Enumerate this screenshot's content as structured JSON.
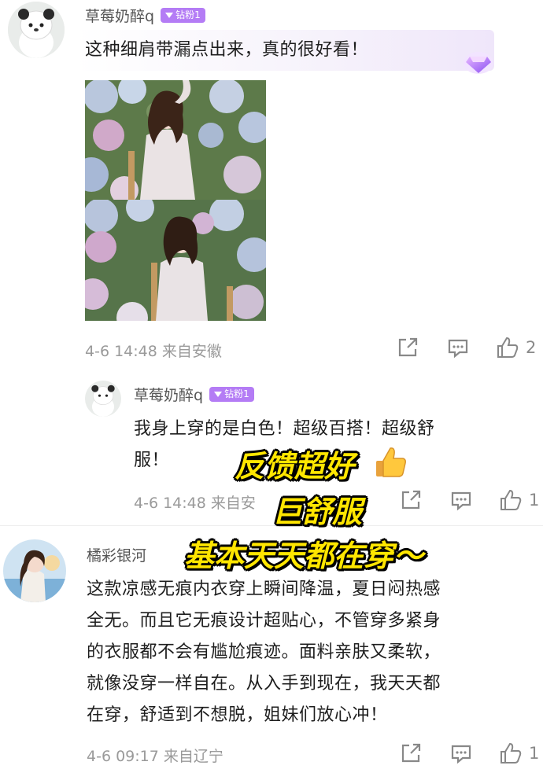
{
  "comment1": {
    "username": "草莓奶醉q",
    "badge": "钻粉1",
    "text": "这种细肩带漏点出来，真的很好看！",
    "time": "4-6 14:48 来自安徽",
    "likes": "2"
  },
  "reply1": {
    "username": "草莓奶醉q",
    "badge": "钻粉1",
    "text_line1": "我身上穿的是白色！超级百搭！超级舒",
    "text_line2": "服！",
    "time": "4-6 14:48 来自安",
    "likes": "1"
  },
  "overlay": {
    "line1": "反馈超好",
    "line2": "巨舒服",
    "line3": "基本天天都在穿～"
  },
  "comment2": {
    "username": "橘彩银河",
    "lines": [
      "这款凉感无痕内衣穿上瞬间降温，夏日闷热感",
      "全无。而且它无痕设计超贴心，不管穿多紧身",
      "的衣服都不会有尴尬痕迹。面料亲肤又柔软，",
      "就像没穿一样自在。从入手到现在，我天天都",
      "在穿，舒适到不想脱，姐妹们放心冲！"
    ],
    "time": "4-6 09:17 来自辽宁",
    "likes": "1"
  },
  "colors": {
    "badge": "#b47cf5",
    "overlay_text": "#ffe600",
    "meta_gray": "#9a9a9a"
  },
  "icons": [
    "share-icon",
    "comment-icon",
    "thumb-up-icon",
    "diamond-icon",
    "thumbs-up-emoji-icon"
  ]
}
